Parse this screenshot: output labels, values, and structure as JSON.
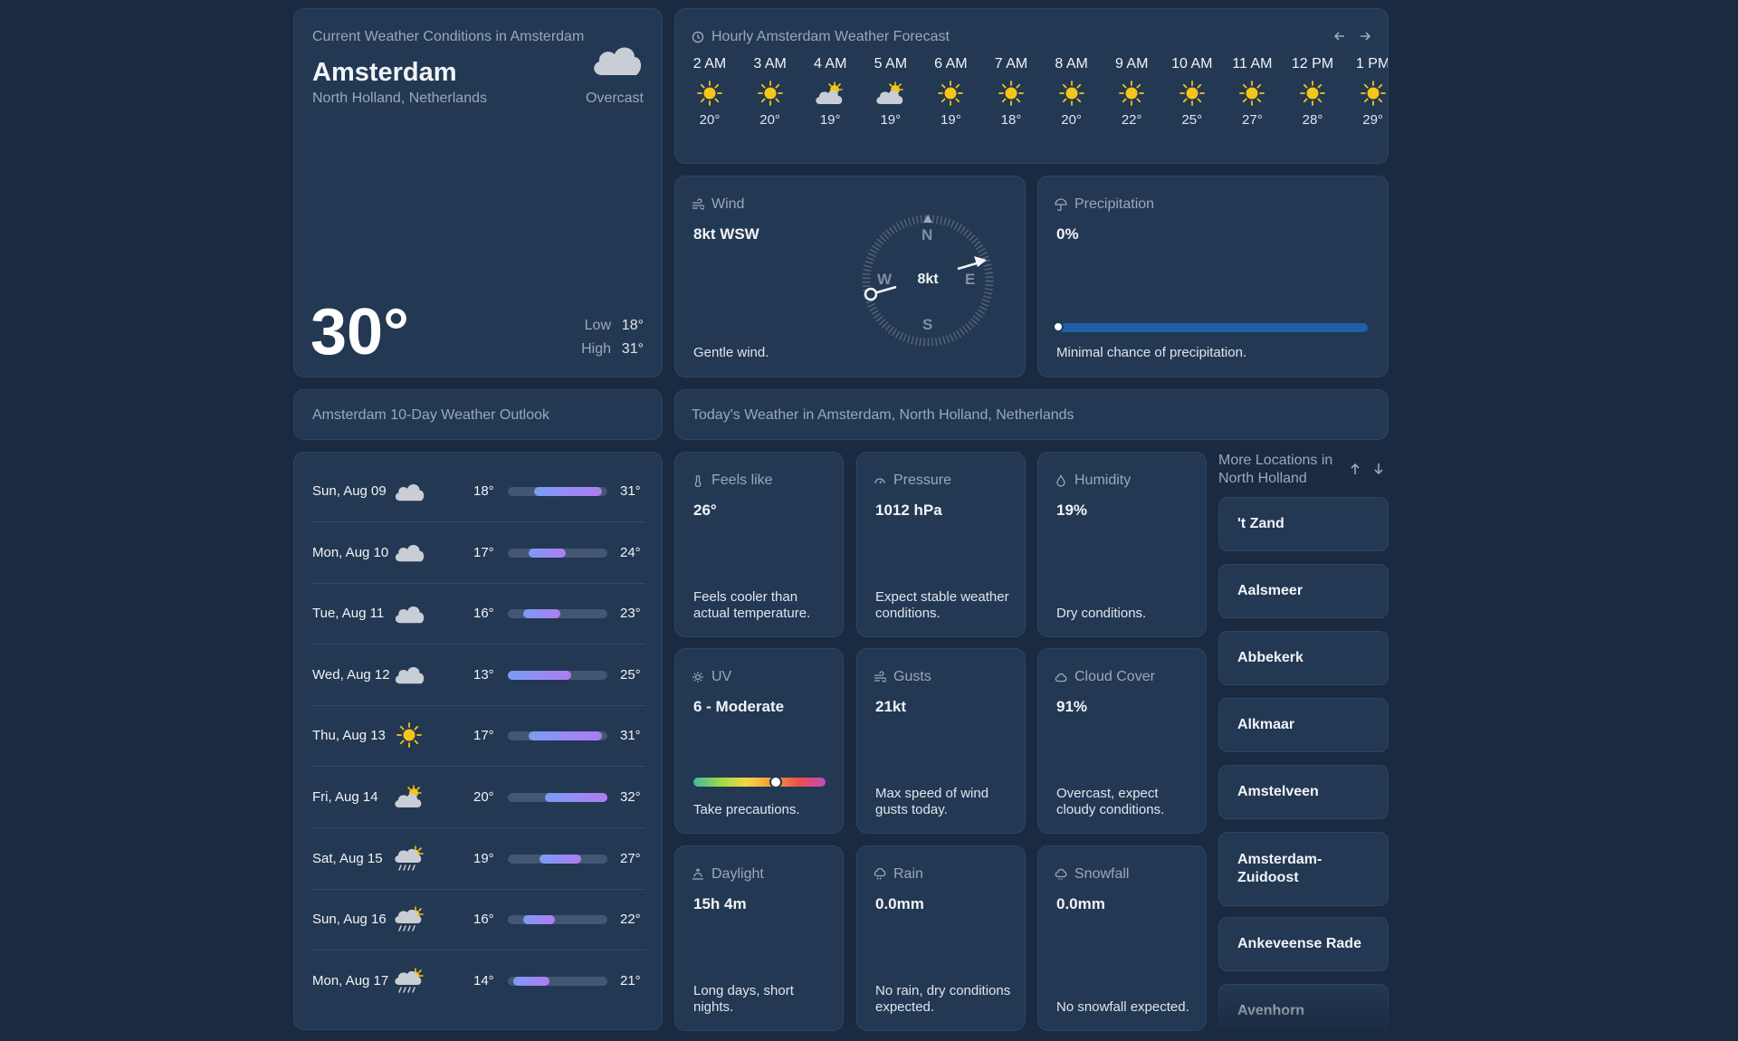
{
  "current": {
    "heading": "Current Weather Conditions in Amsterdam",
    "city": "Amsterdam",
    "region": "North Holland, Netherlands",
    "condition": "Overcast",
    "condition_icon": "cloud-icon",
    "temp": "30°",
    "low_label": "Low",
    "low": "18°",
    "high_label": "High",
    "high": "31°"
  },
  "hourly": {
    "title": "Hourly Amsterdam Weather Forecast",
    "hours": [
      {
        "time": "2 AM",
        "icon": "sun-icon",
        "temp": "20°"
      },
      {
        "time": "3 AM",
        "icon": "sun-icon",
        "temp": "20°"
      },
      {
        "time": "4 AM",
        "icon": "partly-cloudy-icon",
        "temp": "19°"
      },
      {
        "time": "5 AM",
        "icon": "partly-cloudy-icon",
        "temp": "19°"
      },
      {
        "time": "6 AM",
        "icon": "sun-icon",
        "temp": "19°"
      },
      {
        "time": "7 AM",
        "icon": "sun-icon",
        "temp": "18°"
      },
      {
        "time": "8 AM",
        "icon": "sun-icon",
        "temp": "20°"
      },
      {
        "time": "9 AM",
        "icon": "sun-icon",
        "temp": "22°"
      },
      {
        "time": "10 AM",
        "icon": "sun-icon",
        "temp": "25°"
      },
      {
        "time": "11 AM",
        "icon": "sun-icon",
        "temp": "27°"
      },
      {
        "time": "12 PM",
        "icon": "sun-icon",
        "temp": "28°"
      },
      {
        "time": "1 PM",
        "icon": "sun-icon",
        "temp": "29°"
      }
    ]
  },
  "wind": {
    "label": "Wind",
    "value": "8kt WSW",
    "center": "8kt",
    "north": "N",
    "south": "S",
    "east": "E",
    "west": "W",
    "desc": "Gentle wind."
  },
  "precip": {
    "label": "Precipitation",
    "value": "0%",
    "level": 0,
    "desc": "Minimal chance of precipitation."
  },
  "outlook": {
    "title": "Amsterdam 10-Day Weather Outlook"
  },
  "today": {
    "title": "Today's Weather in Amsterdam, North Holland, Netherlands"
  },
  "daily": [
    {
      "day": "Sun, Aug 09",
      "icon": "cloud-icon",
      "low": "18°",
      "high": "31°"
    },
    {
      "day": "Mon, Aug 10",
      "icon": "cloud-icon",
      "low": "17°",
      "high": "24°"
    },
    {
      "day": "Tue, Aug 11",
      "icon": "cloud-icon",
      "low": "16°",
      "high": "23°"
    },
    {
      "day": "Wed, Aug 12",
      "icon": "cloud-icon",
      "low": "13°",
      "high": "25°"
    },
    {
      "day": "Thu, Aug 13",
      "icon": "sun-icon",
      "low": "17°",
      "high": "31°"
    },
    {
      "day": "Fri, Aug 14",
      "icon": "partly-cloudy-icon",
      "low": "20°",
      "high": "32°"
    },
    {
      "day": "Sat, Aug 15",
      "icon": "sun-shower-icon",
      "low": "19°",
      "high": "27°"
    },
    {
      "day": "Sun, Aug 16",
      "icon": "sun-shower-icon",
      "low": "16°",
      "high": "22°"
    },
    {
      "day": "Mon, Aug 17",
      "icon": "sun-shower-icon",
      "low": "14°",
      "high": "21°"
    }
  ],
  "tiles": [
    {
      "label": "Feels like",
      "icon": "thermometer-icon",
      "value": "26°",
      "desc": "Feels cooler than actual temperature."
    },
    {
      "label": "Pressure",
      "icon": "gauge-icon",
      "value": "1012 hPa",
      "desc": "Expect stable weather conditions."
    },
    {
      "label": "Humidity",
      "icon": "droplet-icon",
      "value": "19%",
      "desc": "Dry conditions."
    },
    {
      "label": "UV",
      "icon": "sun-outline-icon",
      "value": "6 - Moderate",
      "desc": "Take precautions.",
      "uv_level": 0.62
    },
    {
      "label": "Gusts",
      "icon": "wind-icon",
      "value": "21kt",
      "desc": "Max speed of wind gusts today."
    },
    {
      "label": "Cloud Cover",
      "icon": "cloud-outline-icon",
      "value": "91%",
      "desc": "Overcast, expect cloudy conditions."
    },
    {
      "label": "Daylight",
      "icon": "sunrise-icon",
      "value": "15h 4m",
      "desc": "Long days, short nights."
    },
    {
      "label": "Rain",
      "icon": "rain-cloud-icon",
      "value": "0.0mm",
      "desc": "No rain, dry conditions expected."
    },
    {
      "label": "Snowfall",
      "icon": "snow-cloud-icon",
      "value": "0.0mm",
      "desc": "No snowfall expected."
    }
  ],
  "locations": {
    "title": "More Locations in North Holland",
    "items": [
      "'t Zand",
      "Aalsmeer",
      "Abbekerk",
      "Alkmaar",
      "Amstelveen",
      "Amsterdam-Zuidoost",
      "Ankeveense Rade",
      "Avenhorn"
    ]
  },
  "colors": {
    "background": "#1a2a40",
    "card": "#233852",
    "sun": "#f5c518",
    "bar_accent": "#9a6cf0",
    "bar_blue": "#7a9cf5",
    "precip_bar": "#1f5fa8"
  }
}
